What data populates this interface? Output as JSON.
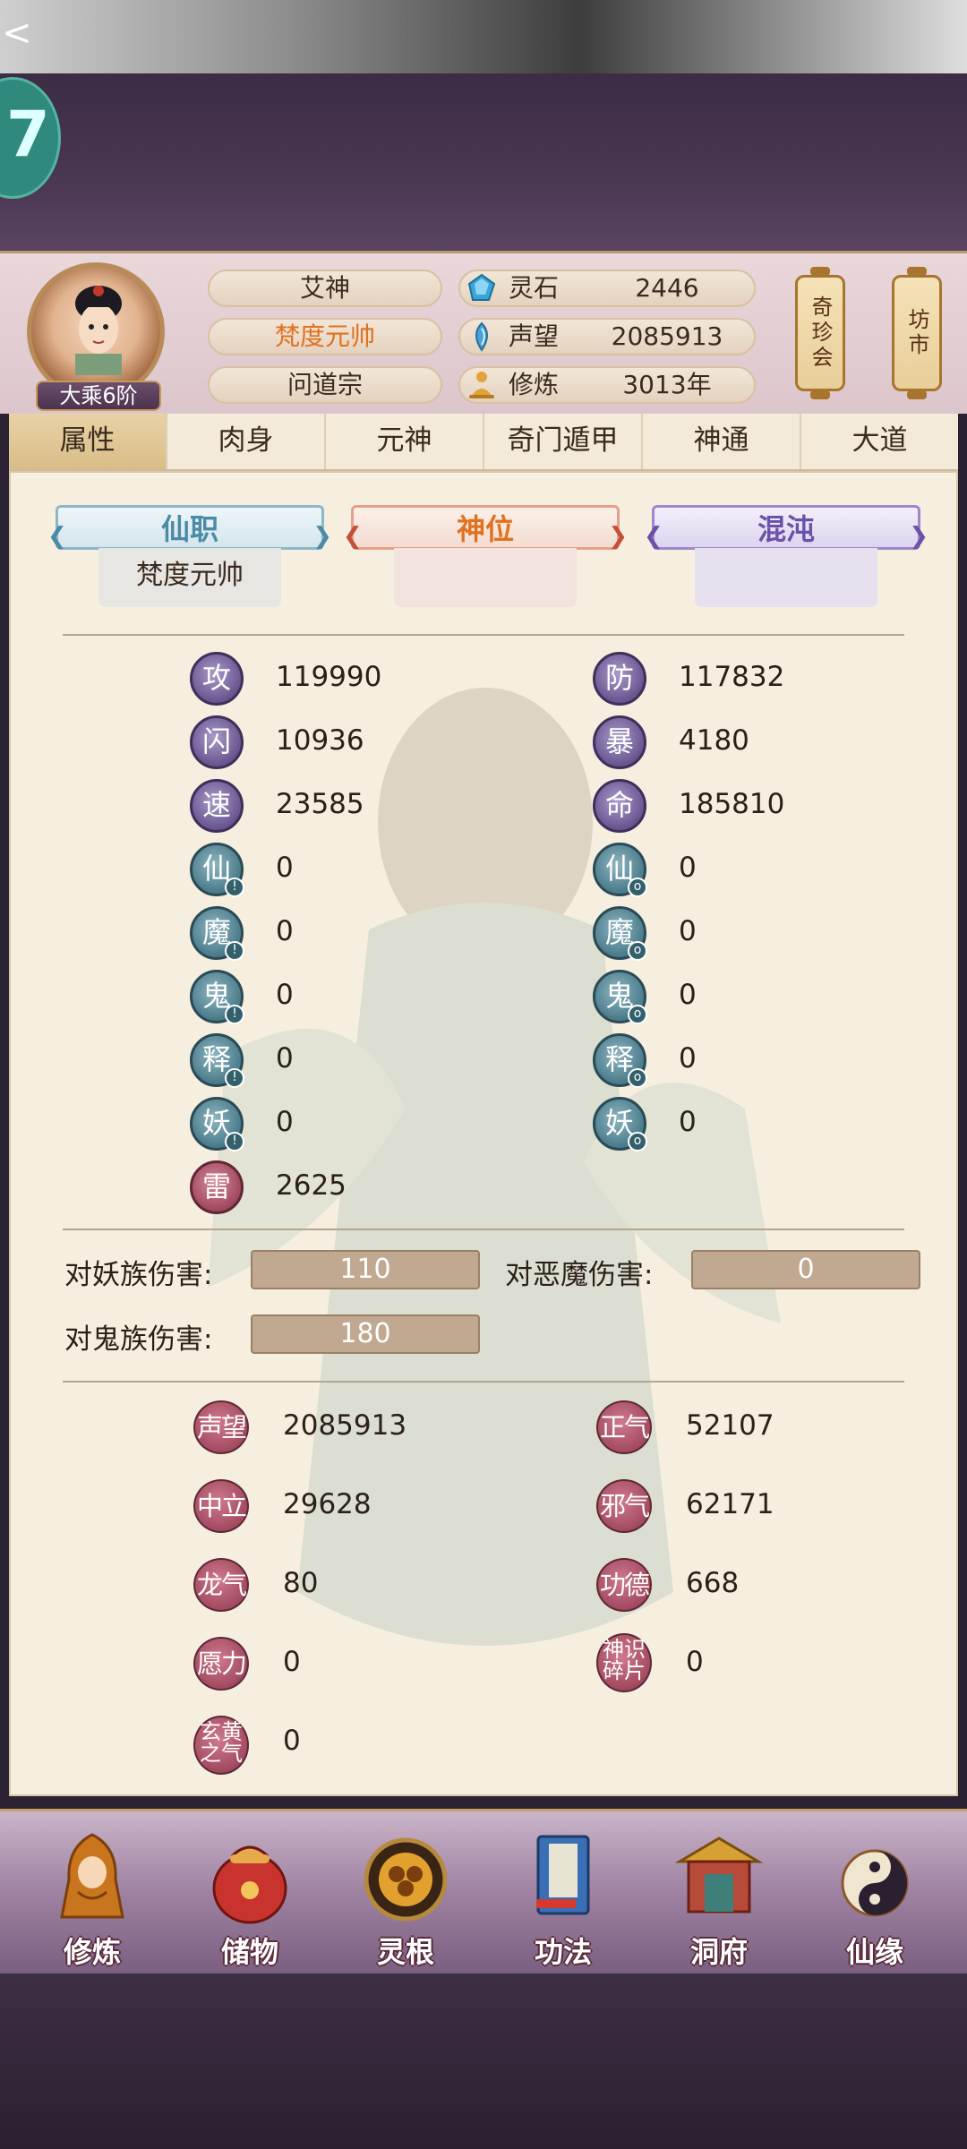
{
  "header": {
    "back_glyph": "<",
    "level": "大乘6阶",
    "title_name": "艾神",
    "rank": "梵度元帅",
    "sect": "问道宗",
    "resources": [
      {
        "icon": "spirit-stone-icon",
        "label": "灵石",
        "value": "2446"
      },
      {
        "icon": "reputation-icon",
        "label": "声望",
        "value": "2085913"
      },
      {
        "icon": "meditation-icon",
        "label": "修炼",
        "value": "3013年"
      }
    ],
    "shortcuts": [
      "奇珍会",
      "坊市"
    ]
  },
  "tabs": [
    {
      "label": "属性",
      "active": true
    },
    {
      "label": "肉身",
      "active": false
    },
    {
      "label": "元神",
      "active": false
    },
    {
      "label": "奇门遁甲",
      "active": false
    },
    {
      "label": "神通",
      "active": false
    },
    {
      "label": "大道",
      "active": false
    }
  ],
  "roles": [
    {
      "title": "仙职",
      "value": "梵度元帅",
      "color": "#4b8ba8"
    },
    {
      "title": "神位",
      "value": "",
      "color": "#e0711f"
    },
    {
      "title": "混沌",
      "value": "",
      "color": "#6a52a8"
    }
  ],
  "stats_left": [
    {
      "glyph": "攻",
      "value": "119990",
      "style": "purple"
    },
    {
      "glyph": "闪",
      "value": "10936",
      "style": "purple"
    },
    {
      "glyph": "速",
      "value": "23585",
      "style": "purple"
    },
    {
      "glyph": "仙",
      "value": "0",
      "style": "teal",
      "mark": "!"
    },
    {
      "glyph": "魔",
      "value": "0",
      "style": "teal",
      "mark": "!"
    },
    {
      "glyph": "鬼",
      "value": "0",
      "style": "teal",
      "mark": "!"
    },
    {
      "glyph": "释",
      "value": "0",
      "style": "teal",
      "mark": "!"
    },
    {
      "glyph": "妖",
      "value": "0",
      "style": "teal",
      "mark": "!"
    },
    {
      "glyph": "雷",
      "value": "2625",
      "style": "red"
    }
  ],
  "stats_right": [
    {
      "glyph": "防",
      "value": "117832",
      "style": "purple"
    },
    {
      "glyph": "暴",
      "value": "4180",
      "style": "purple"
    },
    {
      "glyph": "命",
      "value": "185810",
      "style": "purple"
    },
    {
      "glyph": "仙",
      "value": "0",
      "style": "teal",
      "mark": "o"
    },
    {
      "glyph": "魔",
      "value": "0",
      "style": "teal",
      "mark": "o"
    },
    {
      "glyph": "鬼",
      "value": "0",
      "style": "teal",
      "mark": "o"
    },
    {
      "glyph": "释",
      "value": "0",
      "style": "teal",
      "mark": "o"
    },
    {
      "glyph": "妖",
      "value": "0",
      "style": "teal",
      "mark": "o"
    }
  ],
  "damage": [
    {
      "label": "对妖族伤害:",
      "value": "110"
    },
    {
      "label": "对恶魔伤害:",
      "value": "0"
    },
    {
      "label": "对鬼族伤害:",
      "value": "180"
    }
  ],
  "reputation_left": [
    {
      "label": "声望",
      "value": "2085913"
    },
    {
      "label": "中立",
      "value": "29628"
    },
    {
      "label": "龙气",
      "value": "80"
    },
    {
      "label": "愿力",
      "value": "0"
    },
    {
      "label": "玄黄之气",
      "value": "0"
    }
  ],
  "reputation_right": [
    {
      "label": "正气",
      "value": "52107"
    },
    {
      "label": "邪气",
      "value": "62171"
    },
    {
      "label": "功德",
      "value": "668"
    },
    {
      "label": "神识碎片",
      "value": "0"
    }
  ],
  "bottom_nav": [
    {
      "label": "修炼",
      "icon": "cultivation-icon"
    },
    {
      "label": "储物",
      "icon": "storage-bag-icon"
    },
    {
      "label": "灵根",
      "icon": "spirit-root-icon"
    },
    {
      "label": "功法",
      "icon": "technique-book-icon"
    },
    {
      "label": "洞府",
      "icon": "cave-dwelling-icon"
    },
    {
      "label": "仙缘",
      "icon": "immortal-fate-icon"
    }
  ]
}
